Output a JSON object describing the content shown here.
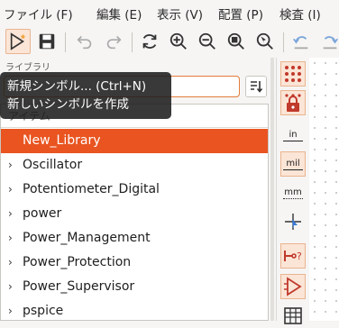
{
  "menubar": {
    "items": [
      "ファイル (F)",
      "編集 (E)",
      "表示 (V)",
      "配置 (P)",
      "検査 (I)"
    ]
  },
  "toolbar": {
    "buttons": [
      "new-symbol-icon",
      "save-icon",
      "undo-icon",
      "redo-icon",
      "refresh-icon",
      "zoom-in-icon",
      "zoom-out-icon",
      "zoom-fit-icon",
      "zoom-selection-icon",
      "rotate-ccw-icon",
      "rotate-cw-icon"
    ]
  },
  "panel": {
    "title": "ライブラリ",
    "search_value": "",
    "tree_header": "アイテム",
    "items": [
      {
        "label": "New_Library",
        "expandable": false,
        "selected": true
      },
      {
        "label": "Oscillator",
        "expandable": true,
        "selected": false
      },
      {
        "label": "Potentiometer_Digital",
        "expandable": true,
        "selected": false
      },
      {
        "label": "power",
        "expandable": true,
        "selected": false
      },
      {
        "label": "Power_Management",
        "expandable": true,
        "selected": false
      },
      {
        "label": "Power_Protection",
        "expandable": true,
        "selected": false
      },
      {
        "label": "Power_Supervisor",
        "expandable": true,
        "selected": false
      },
      {
        "label": "pspice",
        "expandable": true,
        "selected": false
      }
    ]
  },
  "tooltip": {
    "line1": "新規シンボル... (Ctrl+N)",
    "line2": "新しいシンボルを作成"
  },
  "right_toolbar": {
    "unit_in": "in",
    "unit_mil": "mil",
    "unit_mm": "mm",
    "pin_label": "?"
  },
  "colors": {
    "accent": "#e95420",
    "selection": "#e95420"
  }
}
